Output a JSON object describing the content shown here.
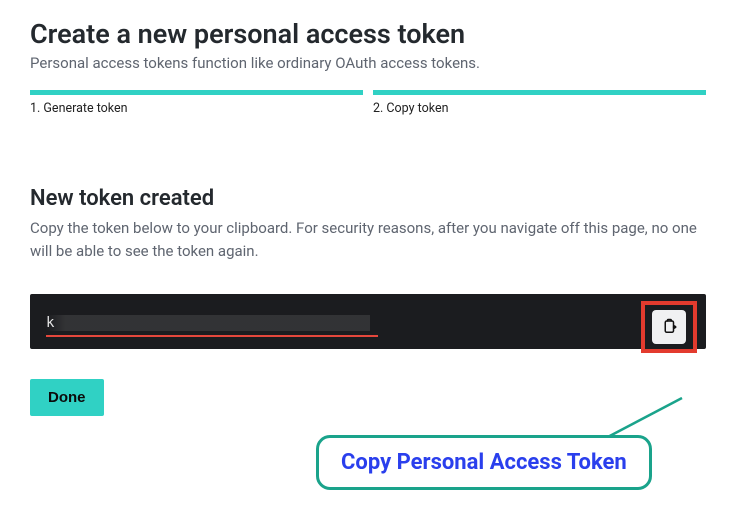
{
  "page": {
    "title": "Create a new personal access token",
    "subtitle": "Personal access tokens function like ordinary OAuth access tokens."
  },
  "steps": [
    {
      "label": "1. Generate token"
    },
    {
      "label": "2. Copy token"
    }
  ],
  "section": {
    "title": "New token created",
    "subtitle": "Copy the token below to your clipboard. For security reasons, after you navigate off this page, no one will be able to see the token again."
  },
  "token": {
    "value": "k"
  },
  "buttons": {
    "done": "Done"
  },
  "callout": {
    "text": "Copy Personal Access Token"
  },
  "icons": {
    "copy": "clipboard-copy-icon"
  },
  "colors": {
    "accent": "#30d1c4",
    "highlight": "#e33b2e",
    "callout_border": "#1aa38b",
    "callout_text": "#2a3fed"
  }
}
